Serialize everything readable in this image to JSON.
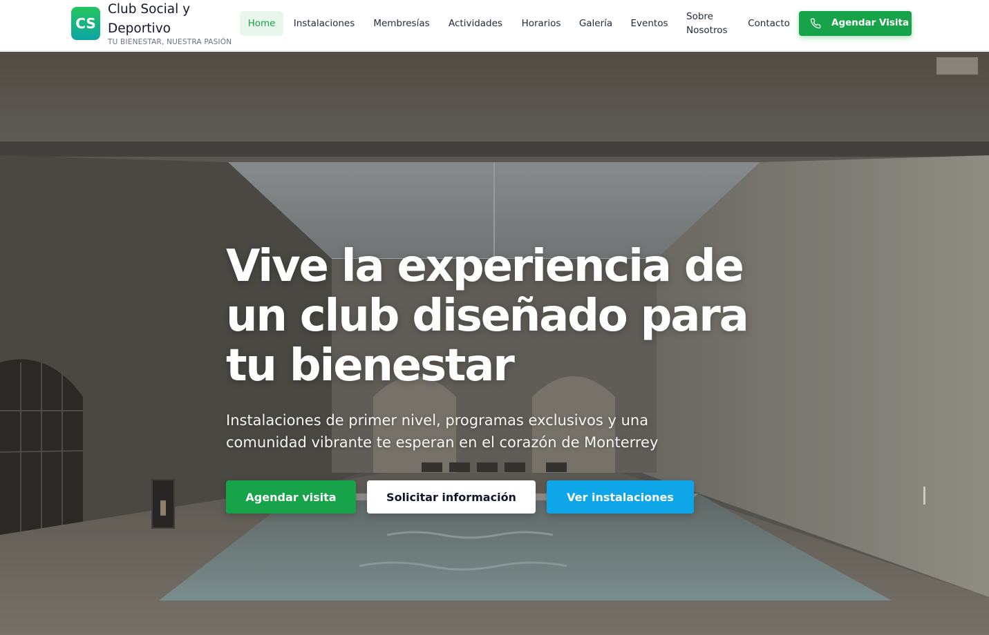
{
  "brand": {
    "logo_initials": "CS",
    "name": "Club Social y Deportivo",
    "tagline": "TU BIENESTAR, NUESTRA PASIÓN"
  },
  "nav": {
    "items": [
      {
        "label": "Home",
        "active": true
      },
      {
        "label": "Instalaciones"
      },
      {
        "label": "Membresías"
      },
      {
        "label": "Actividades"
      },
      {
        "label": "Horarios"
      },
      {
        "label": "Galería"
      },
      {
        "label": "Eventos"
      },
      {
        "label": "Sobre Nosotros"
      },
      {
        "label": "Contacto"
      }
    ],
    "cta_label": "Agendar Visita",
    "cta_icon": "phone-icon"
  },
  "hero": {
    "title": "Vive la experiencia de un club diseñado para tu bienestar",
    "subtitle": "Instalaciones de primer nivel, programas exclusivos y una comunidad vibrante te esperan en el corazón de Monterrey",
    "buttons": {
      "primary": "Agendar visita",
      "secondary": "Solicitar información",
      "tertiary": "Ver instalaciones"
    },
    "background_image": "indoor-pool-photo"
  },
  "colors": {
    "accent_green": "#16a34a",
    "accent_blue": "#0ea5e9",
    "active_nav_bg": "#e9f6ec"
  }
}
